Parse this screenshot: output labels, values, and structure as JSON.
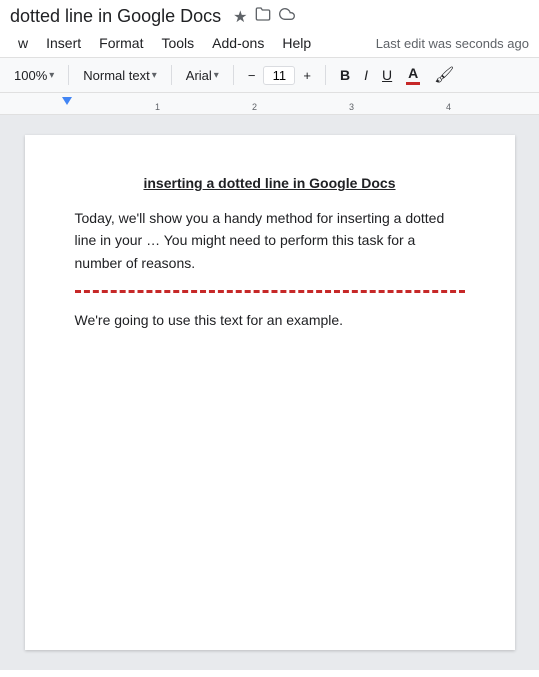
{
  "titleBar": {
    "title": "dotted line in Google Docs",
    "starIcon": "★",
    "folderIcon": "🗀",
    "cloudIcon": "☁"
  },
  "menuBar": {
    "items": [
      "w",
      "Insert",
      "Format",
      "Tools",
      "Add-ons",
      "Help"
    ],
    "lastEdit": "Last edit was seconds ago"
  },
  "toolbar": {
    "zoom": "100%",
    "zoomDropdownArrow": "▾",
    "styleLabel": "Normal text",
    "styleDropdownArrow": "▾",
    "fontLabel": "Arial",
    "fontDropdownArrow": "▾",
    "decrementLabel": "−",
    "fontSize": "11",
    "incrementLabel": "+",
    "boldLabel": "B",
    "italicLabel": "I",
    "underlineLabel": "U",
    "fontColorLetter": "A",
    "highlightLabel": "🖌"
  },
  "document": {
    "heading": "inserting a dotted line in Google Docs",
    "paragraph1": "Today, we'll show you a handy method for inserting a dotted line in your …\nYou might need to perform this task for a number of reasons.",
    "paragraph2": "We're going to use this text for an example."
  },
  "colors": {
    "accent": "#c62828",
    "toolbarBg": "#f8f9fa",
    "pageBg": "#e8eaed"
  }
}
